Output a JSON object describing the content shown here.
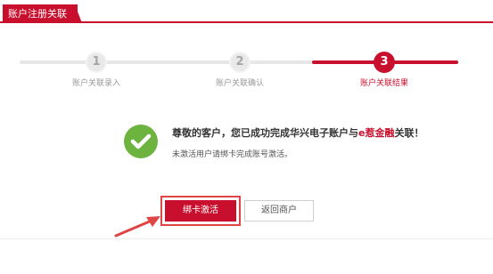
{
  "header": {
    "tab_label": "账户注册关联"
  },
  "steps": [
    {
      "number": "1",
      "label": "账户关联录入",
      "active": false
    },
    {
      "number": "2",
      "label": "账户关联确认",
      "active": false
    },
    {
      "number": "3",
      "label": "账户关联结果",
      "active": true
    }
  ],
  "result": {
    "title_prefix": "尊敬的客户，您已成功完成华兴电子账户与",
    "title_brand": "e惹金融",
    "title_suffix": "关联！",
    "subtitle": "未激活用户请绑卡完成账号激活。"
  },
  "actions": {
    "primary_label": "绑卡激活",
    "secondary_label": "返回商户"
  },
  "colors": {
    "brand_red": "#c8102e",
    "success_green": "#6cb33f",
    "annotation_red": "#e04545"
  }
}
